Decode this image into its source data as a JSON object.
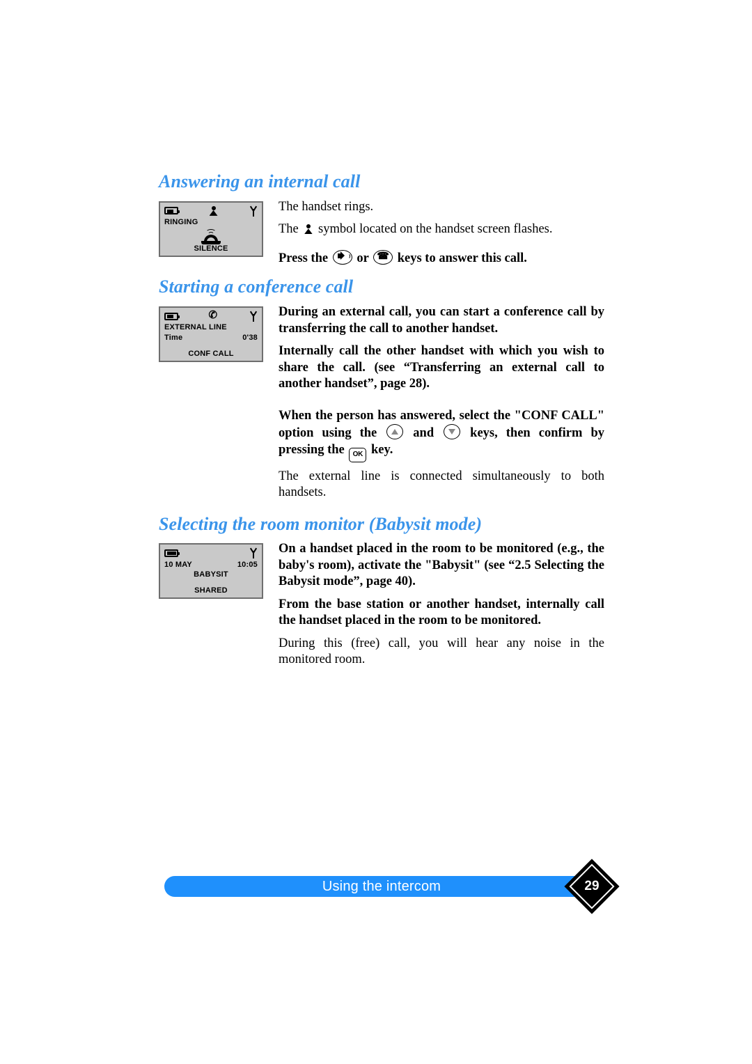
{
  "page": {
    "number": "29",
    "footer_label": "Using the intercom",
    "footer_color": "#1f90fc",
    "heading_color": "#3a94ea"
  },
  "sections": [
    {
      "heading": "Answering an internal call",
      "lcd": {
        "status": {
          "battery": "battery-icon",
          "middle": "person-icon",
          "antenna": "antenna-icon"
        },
        "line1": "RINGING",
        "center_icon": "ringing-phone-icon",
        "softkey": "SILENCE"
      },
      "paragraphs": [
        {
          "bold": false,
          "pre": "The handset rings.",
          "post": ""
        },
        {
          "bold": false,
          "pre": "The ",
          "symbol": "person-icon",
          "post": " symbol located on the handset screen flashes."
        },
        {
          "bold": true,
          "pre": "Press the ",
          "key1": "speaker-key",
          "mid": " or ",
          "key2": "handset-key",
          "post": " keys to answer this call."
        }
      ]
    },
    {
      "heading": "Starting a conference call",
      "lcd": {
        "status": {
          "battery": "battery-icon",
          "middle": "handset-icon",
          "antenna": "antenna-icon"
        },
        "line1": "EXTERNAL LINE",
        "line2_left": "Time",
        "line2_right": "0'38",
        "softkey": "CONF CALL"
      },
      "paragraphs": [
        {
          "bold": true,
          "text": "During an external call, you can start a conference call by transferring the call to another handset."
        },
        {
          "bold": true,
          "text": "Internally call the other handset with which you wish to share the call. (see “Transferring an external call to another handset”, page 28)."
        }
      ],
      "paragraphs_after": [
        {
          "bold": true,
          "pre": "When the person has answered, select the \"CONF CALL\" option using the ",
          "key_up": "arrow-up-key",
          "mid1": " and ",
          "key_down": "arrow-down-key",
          "mid2": " keys, then confirm by pressing the ",
          "key_ok": "OK",
          "post": " key."
        },
        {
          "bold": false,
          "text": "The external line is connected simultaneously to both handsets."
        }
      ]
    },
    {
      "heading": "Selecting the room monitor (Babysit mode)",
      "lcd": {
        "status": {
          "battery": "battery-icon",
          "middle": "",
          "antenna": "antenna-icon"
        },
        "line1_left": "10 MAY",
        "line1_right": "10:05",
        "line2": "BABYSIT",
        "softkey": "SHARED"
      },
      "paragraphs": [
        {
          "bold": true,
          "text": "On a handset placed in the room to be monitored (e.g., the baby's room), activate the \"Babysit\" (see “2.5 Selecting the Babysit mode”, page 40)."
        },
        {
          "bold": true,
          "text": "From the base station or another handset, internally call the handset placed in the room to be monitored."
        },
        {
          "bold": false,
          "text": "During this (free) call, you will hear any noise in the monitored room."
        }
      ]
    }
  ]
}
